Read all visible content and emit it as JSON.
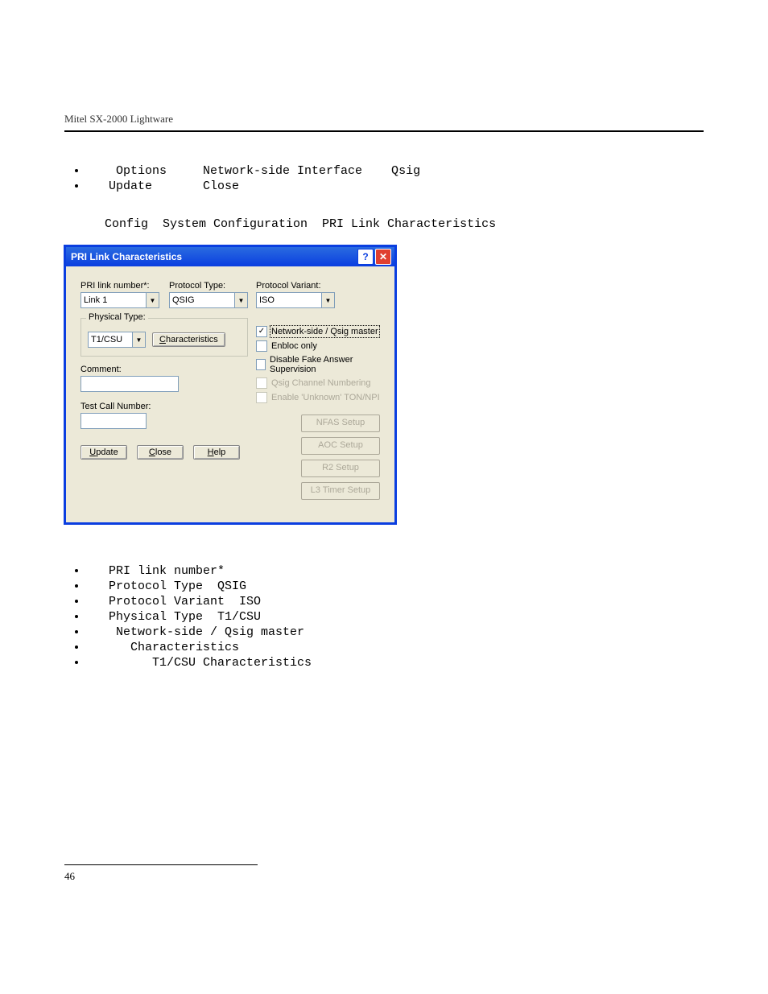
{
  "header": {
    "title": "Mitel SX-2000 Lightware"
  },
  "top_bullets": [
    "    Options     Network-side Interface    Qsig",
    "   Update       Close"
  ],
  "nav_path": "Config  System Configuration  PRI Link Characteristics",
  "dialog": {
    "title": "PRI Link Characteristics",
    "pri_link_number_label": "PRI link number*:",
    "pri_link_number_value": "Link 1",
    "protocol_type_label": "Protocol Type:",
    "protocol_type_value": "QSIG",
    "protocol_variant_label": "Protocol Variant:",
    "protocol_variant_value": "ISO",
    "physical_type_legend": "Physical Type:",
    "physical_type_value": "T1/CSU",
    "characteristics_btn": "Characteristics",
    "comment_label": "Comment:",
    "test_call_label": "Test Call Number:",
    "cb_network_side": "Network-side / Qsig master",
    "cb_enbloc": "Enbloc only",
    "cb_disable_fake": "Disable Fake Answer Supervision",
    "cb_qsig_channel": "Qsig Channel Numbering",
    "cb_enable_unknown": "Enable 'Unknown' TON/NPI",
    "btn_nfas": "NFAS Setup",
    "btn_aoc": "AOC Setup",
    "btn_r2": "R2 Setup",
    "btn_l3": "L3 Timer Setup",
    "btn_update": "Update",
    "btn_close": "Close",
    "btn_help": "Help"
  },
  "bottom_bullets": [
    "   PRI link number*",
    "   Protocol Type  QSIG",
    "   Protocol Variant  ISO",
    "   Physical Type  T1/CSU",
    "    Network-side / Qsig master",
    "      Characteristics",
    "         T1/CSU Characteristics"
  ],
  "page_number": "46"
}
